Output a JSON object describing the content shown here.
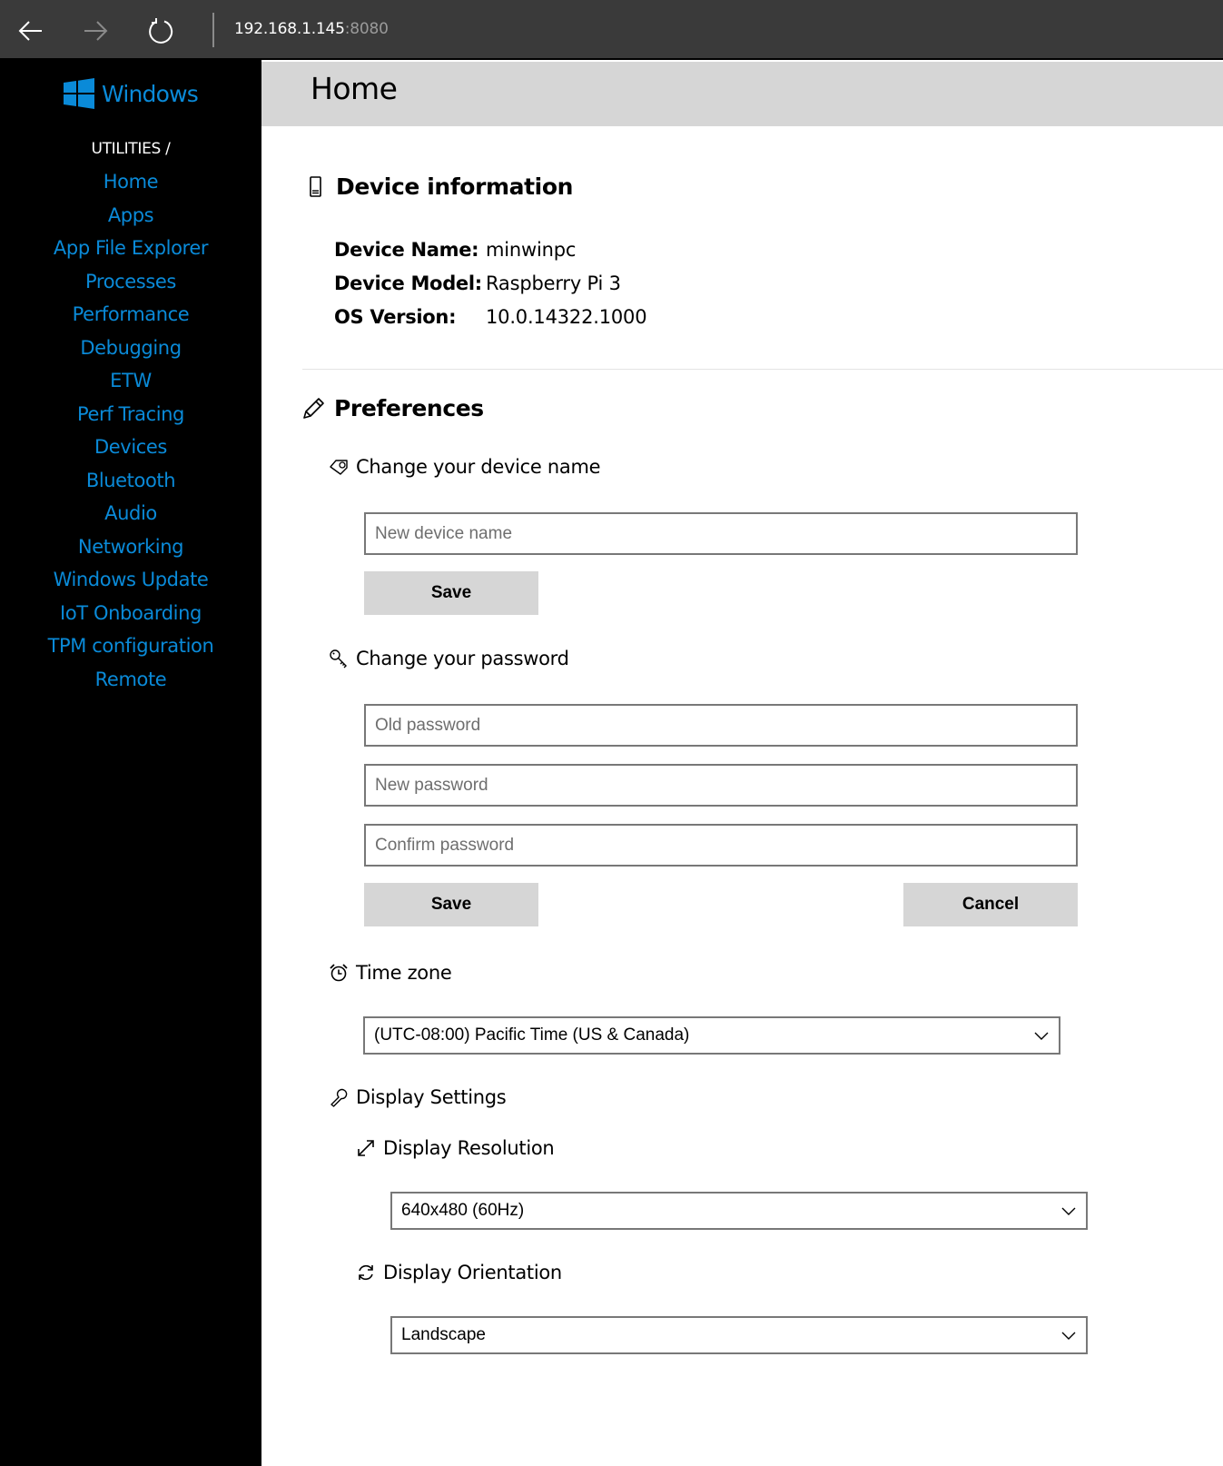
{
  "browser": {
    "address_host": "192.168.1.145",
    "address_port": ":8080",
    "icons": {
      "back": "arrow-left-icon",
      "forward": "arrow-right-icon",
      "reload": "reload-icon"
    }
  },
  "sidebar": {
    "logo_text": "Windows",
    "breadcrumb": "UTILITIES /",
    "items": [
      {
        "label": "Home"
      },
      {
        "label": "Apps"
      },
      {
        "label": "App File Explorer"
      },
      {
        "label": "Processes"
      },
      {
        "label": "Performance"
      },
      {
        "label": "Debugging"
      },
      {
        "label": "ETW"
      },
      {
        "label": "Perf Tracing"
      },
      {
        "label": "Devices"
      },
      {
        "label": "Bluetooth"
      },
      {
        "label": "Audio"
      },
      {
        "label": "Networking"
      },
      {
        "label": "Windows Update"
      },
      {
        "label": "IoT Onboarding"
      },
      {
        "label": "TPM configuration"
      },
      {
        "label": "Remote"
      }
    ],
    "accent_color": "#0a8ad8"
  },
  "page": {
    "title": "Home"
  },
  "device_info": {
    "title": "Device information",
    "icon": "phone-icon",
    "rows": [
      {
        "label": "Device Name:",
        "value": "minwinpc"
      },
      {
        "label": "Device Model:",
        "value": "Raspberry Pi 3"
      },
      {
        "label": "OS Version:",
        "value": "10.0.14322.1000"
      }
    ]
  },
  "preferences": {
    "title": "Preferences",
    "icon": "pencil-icon",
    "device_name": {
      "title": "Change your device name",
      "icon": "tag-icon",
      "input_placeholder": "New device name",
      "input_value": "",
      "save_label": "Save"
    },
    "password": {
      "title": "Change your password",
      "icon": "key-icon",
      "old_placeholder": "Old password",
      "new_placeholder": "New password",
      "confirm_placeholder": "Confirm password",
      "save_label": "Save",
      "cancel_label": "Cancel"
    },
    "timezone": {
      "title": "Time zone",
      "icon": "alarm-clock-icon",
      "selected": "(UTC-08:00) Pacific Time (US & Canada)"
    },
    "display": {
      "title": "Display Settings",
      "icon": "wrench-icon",
      "resolution": {
        "title": "Display Resolution",
        "icon": "resize-icon",
        "selected": "640x480 (60Hz)"
      },
      "orientation": {
        "title": "Display Orientation",
        "icon": "rotate-icon",
        "selected": "Landscape"
      }
    }
  }
}
